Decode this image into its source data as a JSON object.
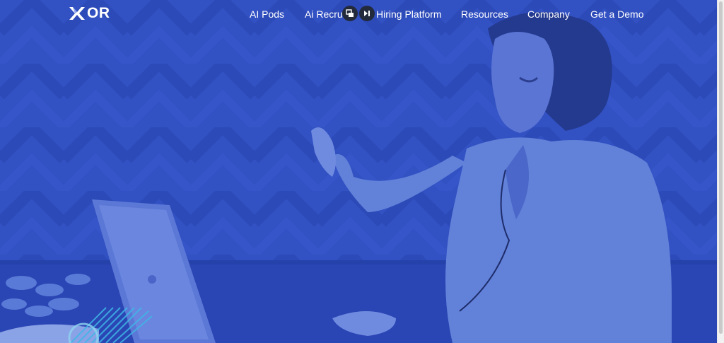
{
  "brand": {
    "logo_text": "OR",
    "logo_icon": "x-mark-logo-icon"
  },
  "nav": {
    "items": [
      {
        "label": "AI Pods"
      },
      {
        "label": "Ai Recruiter"
      },
      {
        "label": "Hiring Platform"
      },
      {
        "label": "Resources"
      },
      {
        "label": "Company"
      },
      {
        "label": "Get a Demo"
      }
    ]
  },
  "media_controls": [
    {
      "icon": "picture-in-picture-icon"
    },
    {
      "icon": "skip-next-icon"
    }
  ],
  "colors": {
    "overlay_blue": "#2f4fc4",
    "text": "#ffffff",
    "accent_cyan": "#3fb7e6",
    "control_bg": "#222a3c"
  }
}
